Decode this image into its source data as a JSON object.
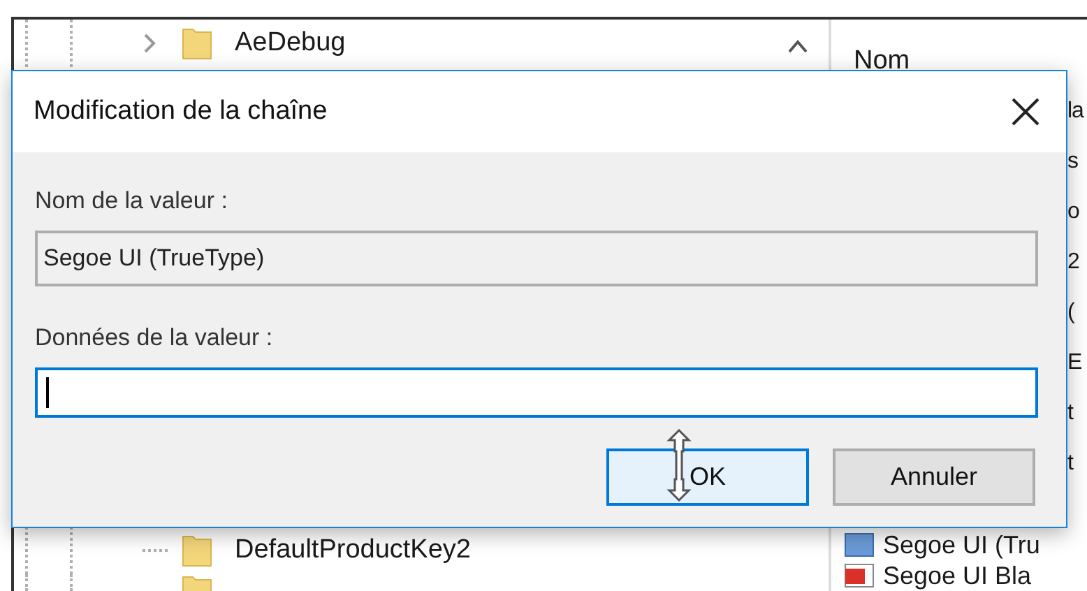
{
  "tree": {
    "items": [
      {
        "label": "AeDebug",
        "expandable": true
      },
      {
        "label": "DefaultProductKey2",
        "expandable": false
      }
    ]
  },
  "list": {
    "header": "Nom",
    "rows": [
      {
        "kind": "fragment",
        "text": "la"
      },
      {
        "kind": "fragment",
        "text": "s"
      },
      {
        "kind": "fragment",
        "text": "o"
      },
      {
        "kind": "fragment",
        "text": "2"
      },
      {
        "kind": "fragment",
        "text": "("
      },
      {
        "kind": "fragment",
        "text": "E"
      },
      {
        "kind": "fragment",
        "text": "t"
      },
      {
        "kind": "fragment",
        "text": "t"
      },
      {
        "kind": "binary",
        "text": "Segoe UI (Tru"
      },
      {
        "kind": "string",
        "text": "Segoe UI Bla"
      }
    ]
  },
  "dialog": {
    "title": "Modification de la chaîne",
    "name_label": "Nom de la valeur :",
    "name_value": "Segoe UI (TrueType)",
    "data_label": "Données de la valeur :",
    "data_focused": true,
    "buttons": [
      {
        "label": "OK",
        "default": true
      },
      {
        "label": "Annuler",
        "default": false
      }
    ]
  }
}
